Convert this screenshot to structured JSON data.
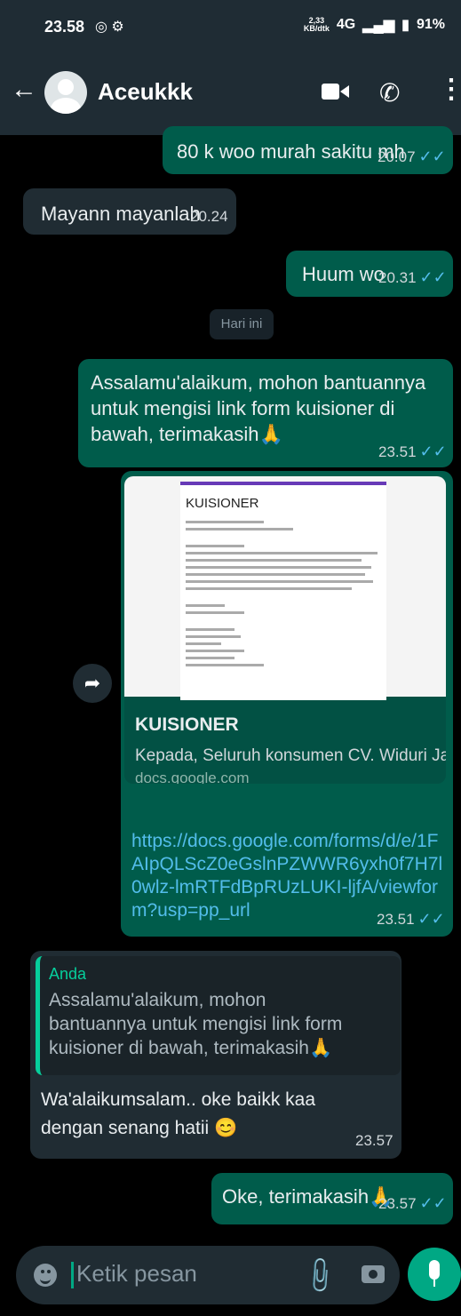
{
  "status_bar": {
    "time": "23.58",
    "net_speed": "2,33",
    "net_unit": "KB/dtk",
    "network": "4G",
    "battery": "91%"
  },
  "header": {
    "contact_name": "Aceukkk"
  },
  "messages": [
    {
      "text": "80 k woo murah sakitu mh",
      "time": "20.07",
      "ticks": "✓✓"
    },
    {
      "text": "Mayann mayanlah",
      "time": "20.24"
    },
    {
      "text": "Huum wo",
      "time": "20.31",
      "ticks": "✓✓"
    },
    {
      "text": "Assalamu'alaikum, mohon bantuannya untuk mengisi link form kuisioner di bawah, terimakasih🙏",
      "time": "23.51",
      "ticks": "✓✓"
    },
    {
      "time": "23.51",
      "ticks": "✓✓"
    },
    {
      "text": "Wa'alaikumsalam.. oke baikk kaa dengan senang hatii 😊",
      "time": "23.57"
    },
    {
      "text": "Oke, terimakasih🙏",
      "time": "23.57",
      "ticks": "✓✓"
    }
  ],
  "date_chip": "Hari ini",
  "link_preview": {
    "doc_heading": "KUISIONER",
    "title": "KUISIONER",
    "description": "Kepada, Seluruh konsumen CV. Widuri Jaya ...",
    "domain": "docs.google.com",
    "url": "https://docs.google.com/forms/d/e/1FAIpQLScZ0eGslnPZWWR6yxh0f7H7l0wlz-lmRTFdBpRUzLUKI-ljfA/viewform?usp=pp_url"
  },
  "reply_quote": {
    "author": "Anda",
    "text": "Assalamu'alaikum, mohon bantuannya untuk mengisi link form kuisioner di bawah, terimakasih🙏"
  },
  "input": {
    "placeholder": "Ketik pesan"
  },
  "colors": {
    "outgoing": "#005c4b",
    "incoming": "#202c33",
    "accent": "#00a884",
    "ticks": "#53bdeb"
  }
}
